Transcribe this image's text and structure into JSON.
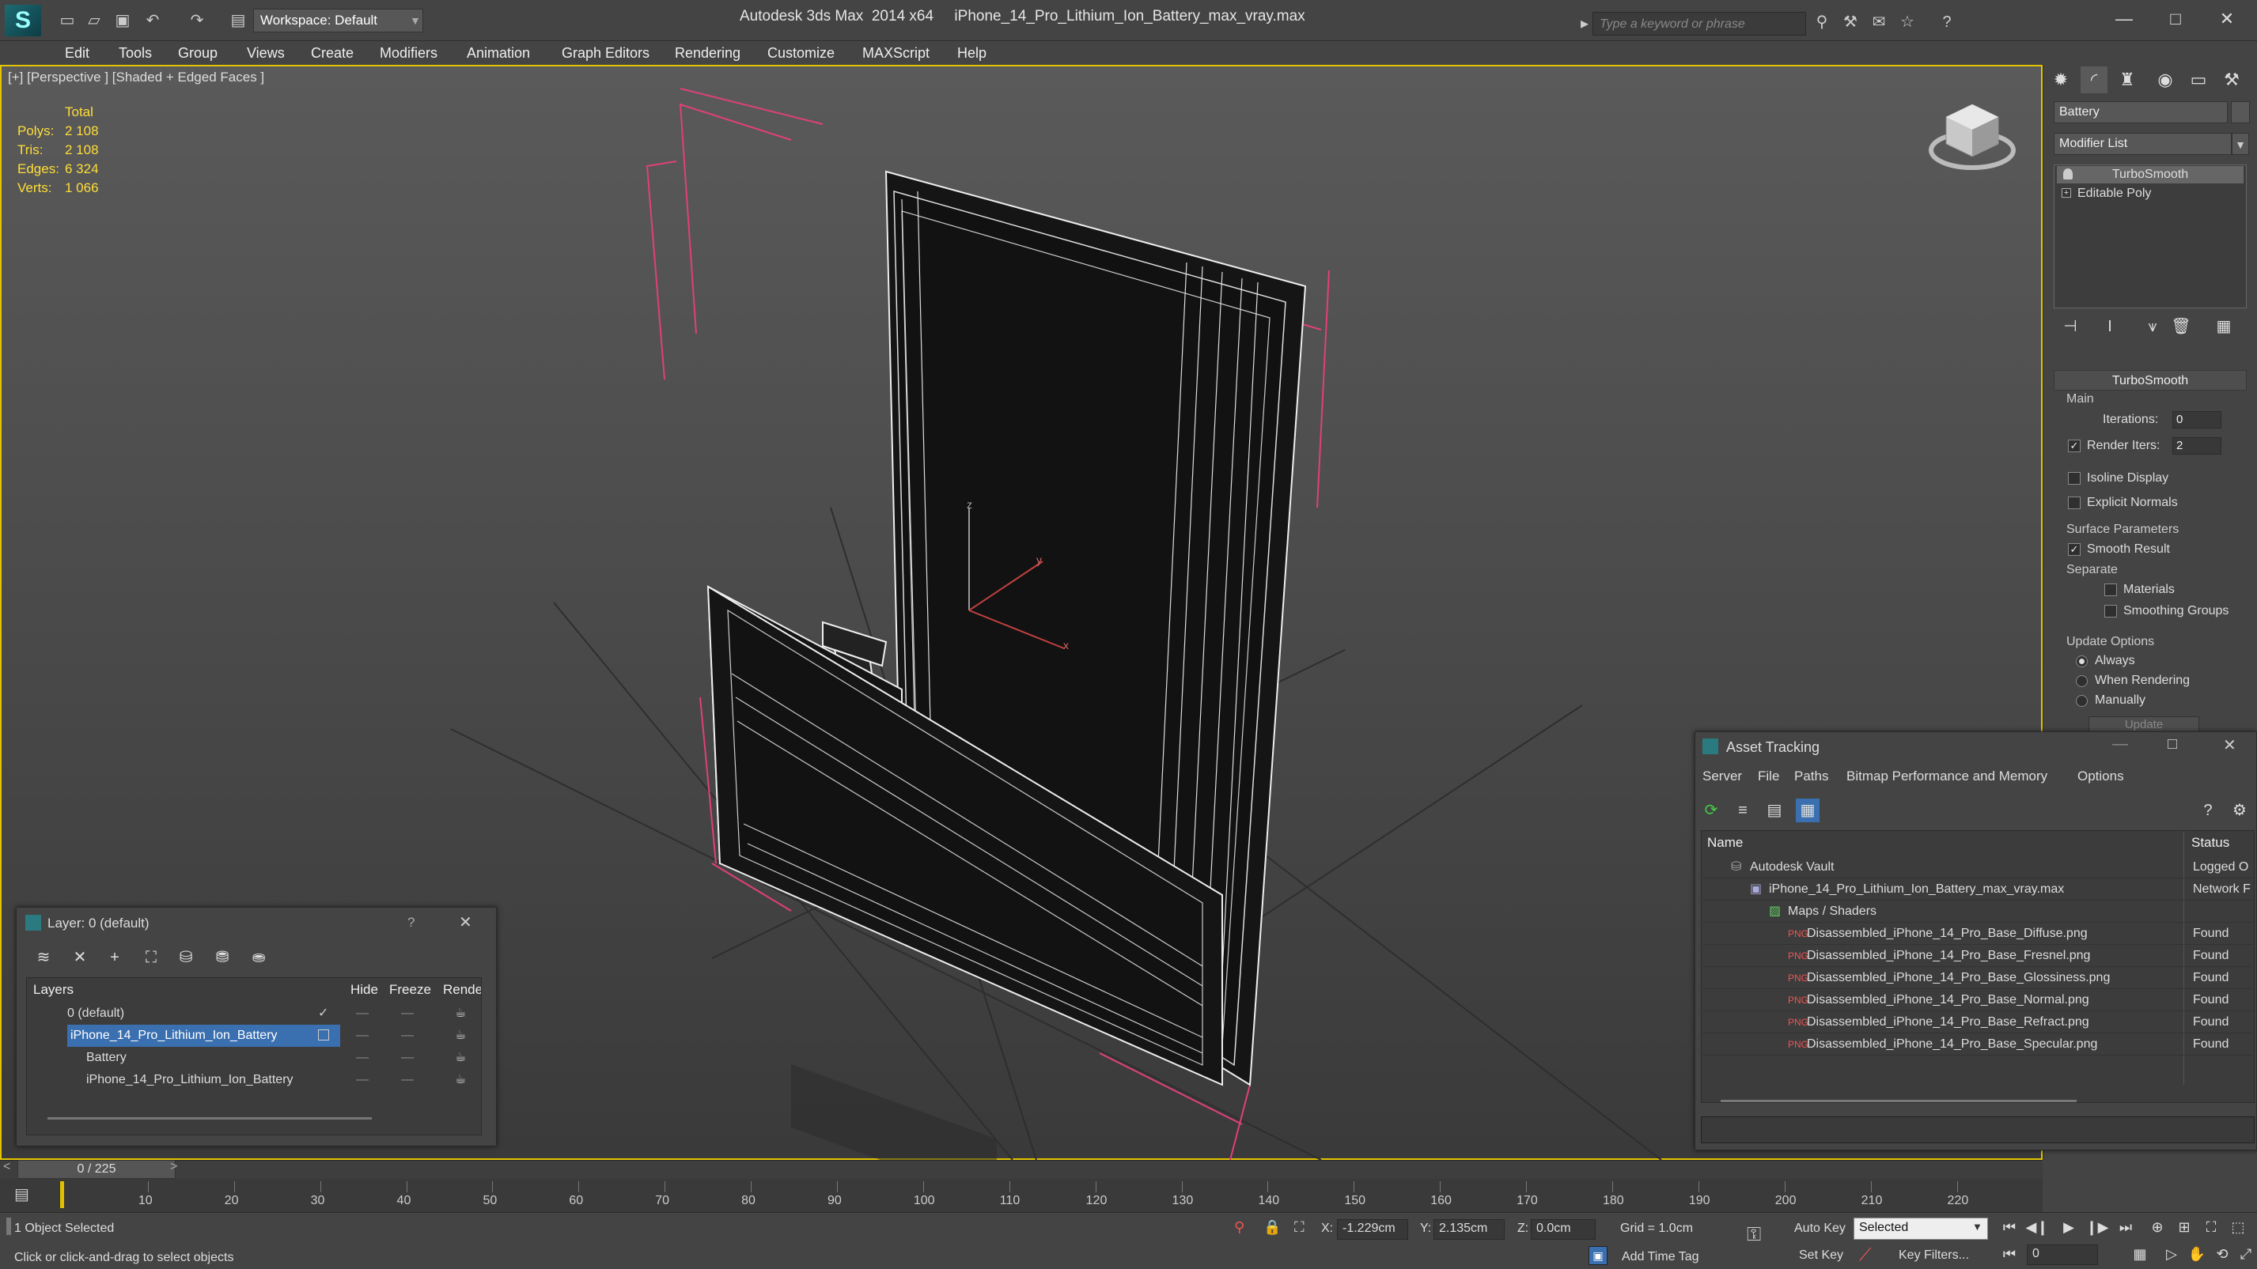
{
  "app": {
    "logo": "S",
    "title": "Autodesk 3ds Max  2014 x64     iPhone_14_Pro_Lithium_Ion_Battery_max_vray.max",
    "workspace_label": "Workspace: Default",
    "search_placeholder": "Type a keyword or phrase"
  },
  "menu": [
    "Edit",
    "Tools",
    "Group",
    "Views",
    "Create",
    "Modifiers",
    "Animation",
    "Graph Editors",
    "Rendering",
    "Customize",
    "MAXScript",
    "Help"
  ],
  "viewport": {
    "label": "[+] [Perspective ] [Shaded + Edged Faces ]",
    "stats": {
      "header": "Total",
      "rows": [
        {
          "label": "Polys:",
          "value": "2 108"
        },
        {
          "label": "Tris:",
          "value": "2 108"
        },
        {
          "label": "Edges:",
          "value": "6 324"
        },
        {
          "label": "Verts:",
          "value": "1 066"
        }
      ]
    },
    "axis": {
      "x": "x",
      "y": "y",
      "z": "z"
    }
  },
  "command_panel": {
    "object_name": "Battery",
    "modifier_list": "Modifier List",
    "stack": [
      "TurboSmooth",
      "Editable Poly"
    ],
    "turbosmooth": {
      "title": "TurboSmooth",
      "main": "Main",
      "iterations_label": "Iterations:",
      "iterations": "0",
      "render_iters_label": "Render Iters:",
      "render_iters": "2",
      "isoline": "Isoline Display",
      "explicit_normals": "Explicit Normals",
      "surface_params": "Surface Parameters",
      "smooth_result": "Smooth Result",
      "separate": "Separate",
      "materials": "Materials",
      "smoothing_groups": "Smoothing Groups",
      "update_options": "Update Options",
      "always": "Always",
      "when_rendering": "When Rendering",
      "manually": "Manually",
      "update": "Update"
    }
  },
  "layer_window": {
    "title": "Layer: 0 (default)",
    "help": "?",
    "columns": [
      "Layers",
      "Hide",
      "Freeze",
      "Rende"
    ],
    "rows": [
      {
        "name": "0 (default)",
        "indent": 0
      },
      {
        "name": "iPhone_14_Pro_Lithium_Ion_Battery",
        "indent": 0,
        "selected": true
      },
      {
        "name": "Battery",
        "indent": 1
      },
      {
        "name": "iPhone_14_Pro_Lithium_Ion_Battery",
        "indent": 1
      }
    ]
  },
  "asset_tracking": {
    "title": "Asset Tracking",
    "menu": [
      "Server",
      "File",
      "Paths",
      "Bitmap Performance and Memory",
      "Options"
    ],
    "columns": [
      "Name",
      "Status"
    ],
    "rows": [
      {
        "name": "Autodesk Vault",
        "status": "Logged O",
        "indent": 0,
        "icon": "vault-icon"
      },
      {
        "name": "iPhone_14_Pro_Lithium_Ion_Battery_max_vray.max",
        "status": "Network F",
        "indent": 1,
        "icon": "max-file-icon"
      },
      {
        "name": "Maps / Shaders",
        "status": "",
        "indent": 2,
        "icon": "maps-icon"
      },
      {
        "name": "Disassembled_iPhone_14_Pro_Base_Diffuse.png",
        "status": "Found",
        "indent": 3,
        "icon": "png-icon"
      },
      {
        "name": "Disassembled_iPhone_14_Pro_Base_Fresnel.png",
        "status": "Found",
        "indent": 3,
        "icon": "png-icon"
      },
      {
        "name": "Disassembled_iPhone_14_Pro_Base_Glossiness.png",
        "status": "Found",
        "indent": 3,
        "icon": "png-icon"
      },
      {
        "name": "Disassembled_iPhone_14_Pro_Base_Normal.png",
        "status": "Found",
        "indent": 3,
        "icon": "png-icon"
      },
      {
        "name": "Disassembled_iPhone_14_Pro_Base_Refract.png",
        "status": "Found",
        "indent": 3,
        "icon": "png-icon"
      },
      {
        "name": "Disassembled_iPhone_14_Pro_Base_Specular.png",
        "status": "Found",
        "indent": 3,
        "icon": "png-icon"
      }
    ]
  },
  "timeline": {
    "frame": "0 / 225",
    "ticks": [
      "10",
      "20",
      "30",
      "40",
      "50",
      "60",
      "70",
      "80",
      "90",
      "100",
      "110",
      "120",
      "130",
      "140",
      "150",
      "160",
      "170",
      "180",
      "190",
      "200",
      "210",
      "220"
    ]
  },
  "status": {
    "selection": "1 Object Selected",
    "prompt": "Click or click-and-drag to select objects",
    "x_label": "X:",
    "x": "-1.229cm",
    "y_label": "Y:",
    "y": "2.135cm",
    "z_label": "Z:",
    "z": "0.0cm",
    "grid": "Grid = 1.0cm",
    "auto_key": "Auto Key",
    "set_key": "Set Key",
    "selected": "Selected",
    "key_filters": "Key Filters...",
    "add_time_tag": "Add Time Tag",
    "frame_field": "0"
  },
  "colors": {
    "accent_selected": "#3a6fb0",
    "stats": "#ffde38",
    "viewport_border": "#e4c400"
  }
}
